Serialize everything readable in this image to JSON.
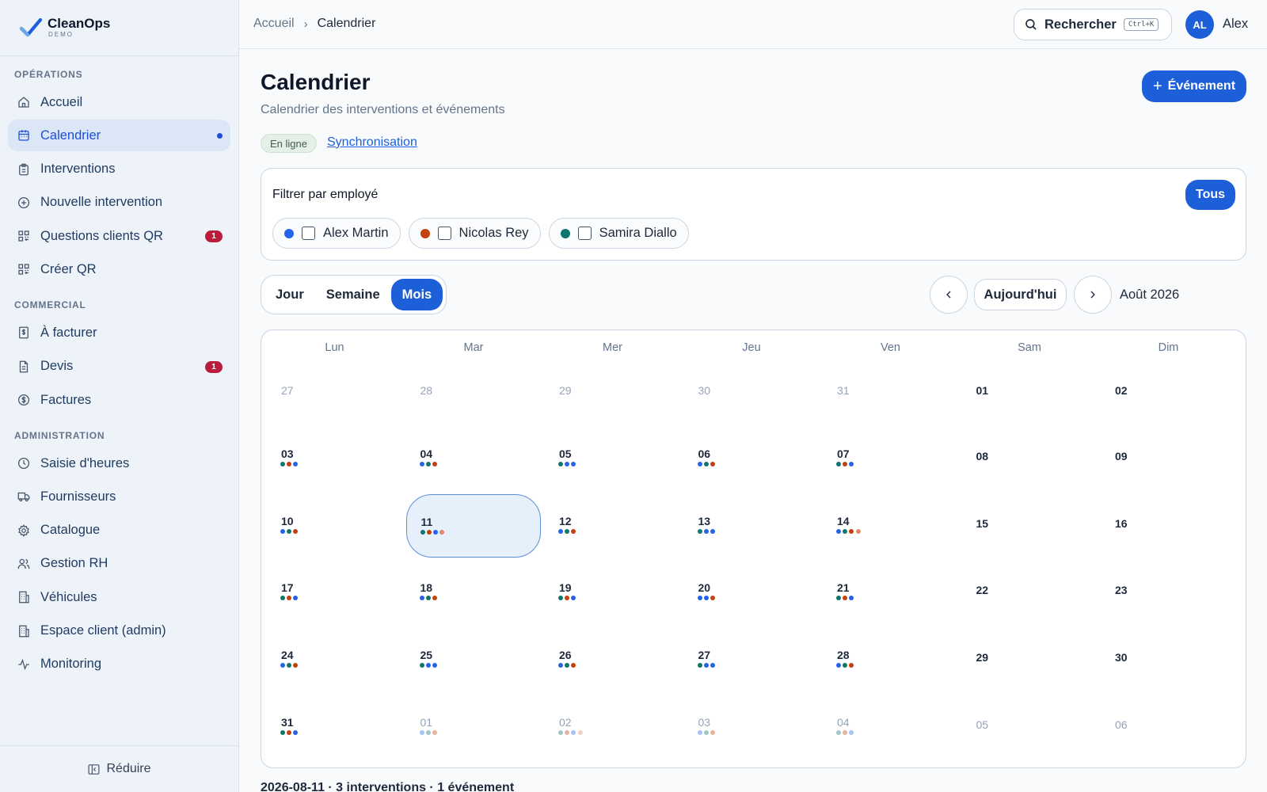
{
  "brand": {
    "name": "CleanOps",
    "sub": "DEMO"
  },
  "sidebar": {
    "sections": [
      {
        "title": "OPÉRATIONS",
        "items": [
          {
            "label": "Accueil",
            "icon": "home-icon"
          },
          {
            "label": "Calendrier",
            "icon": "calendar-icon",
            "active": true
          },
          {
            "label": "Interventions",
            "icon": "clipboard-icon"
          },
          {
            "label": "Nouvelle intervention",
            "icon": "plus-circle-icon"
          },
          {
            "label": "Questions clients QR",
            "icon": "qr-icon",
            "badge": "1"
          },
          {
            "label": "Créer QR",
            "icon": "qr-icon"
          }
        ]
      },
      {
        "title": "COMMERCIAL",
        "items": [
          {
            "label": "À facturer",
            "icon": "invoice-icon"
          },
          {
            "label": "Devis",
            "icon": "document-icon",
            "badge": "1"
          },
          {
            "label": "Factures",
            "icon": "dollar-circle-icon"
          }
        ]
      },
      {
        "title": "ADMINISTRATION",
        "items": [
          {
            "label": "Saisie d'heures",
            "icon": "clock-icon"
          },
          {
            "label": "Fournisseurs",
            "icon": "truck-icon"
          },
          {
            "label": "Catalogue",
            "icon": "gear-icon"
          },
          {
            "label": "Gestion RH",
            "icon": "users-icon"
          },
          {
            "label": "Véhicules",
            "icon": "building-icon"
          },
          {
            "label": "Espace client (admin)",
            "icon": "building-icon"
          },
          {
            "label": "Monitoring",
            "icon": "activity-icon"
          }
        ]
      }
    ],
    "collapse_label": "Réduire"
  },
  "topbar": {
    "breadcrumb_home": "Accueil",
    "breadcrumb_sep": "›",
    "breadcrumb_current": "Calendrier",
    "search_label": "Rechercher",
    "search_shortcut": "Ctrl+K",
    "user_initials": "AL",
    "user_name": "Alex"
  },
  "page": {
    "title": "Calendrier",
    "subtitle": "Calendrier des interventions et événements",
    "add_event_label": "Événement",
    "status": "En ligne",
    "sync_link": "Synchronisation"
  },
  "filter": {
    "title": "Filtrer par employé",
    "all_label": "Tous",
    "employees": [
      {
        "name": "Alex Martin",
        "color": "#2563eb"
      },
      {
        "name": "Nicolas Rey",
        "color": "#c2410c"
      },
      {
        "name": "Samira Diallo",
        "color": "#0f766e"
      }
    ]
  },
  "views": {
    "day": "Jour",
    "week": "Semaine",
    "month": "Mois",
    "active": "month"
  },
  "nav": {
    "today_label": "Aujourd'hui",
    "month_label": "Août 2026"
  },
  "colors": {
    "alex": "#2563eb",
    "nicolas": "#c2410c",
    "samira": "#0f766e",
    "event": "#e08a6d"
  },
  "calendar": {
    "weekdays": [
      "Lun",
      "Mar",
      "Mer",
      "Jeu",
      "Ven",
      "Sam",
      "Dim"
    ],
    "selected": "11",
    "weeks": [
      [
        {
          "n": "27",
          "other": true,
          "dots": []
        },
        {
          "n": "28",
          "other": true,
          "dots": []
        },
        {
          "n": "29",
          "other": true,
          "dots": []
        },
        {
          "n": "30",
          "other": true,
          "dots": []
        },
        {
          "n": "31",
          "other": true,
          "dots": []
        },
        {
          "n": "01",
          "dots": []
        },
        {
          "n": "02",
          "dots": []
        }
      ],
      [
        {
          "n": "03",
          "dots": [
            "samira",
            "nicolas",
            "alex"
          ]
        },
        {
          "n": "04",
          "dots": [
            "alex",
            "samira",
            "nicolas"
          ]
        },
        {
          "n": "05",
          "dots": [
            "samira",
            "alex",
            "alex"
          ]
        },
        {
          "n": "06",
          "dots": [
            "alex",
            "samira",
            "nicolas"
          ]
        },
        {
          "n": "07",
          "dots": [
            "samira",
            "nicolas",
            "alex"
          ]
        },
        {
          "n": "08",
          "dots": []
        },
        {
          "n": "09",
          "dots": []
        }
      ],
      [
        {
          "n": "10",
          "dots": [
            "alex",
            "samira",
            "nicolas"
          ]
        },
        {
          "n": "11",
          "dots": [
            "samira",
            "nicolas",
            "alex",
            "event"
          ]
        },
        {
          "n": "12",
          "dots": [
            "alex",
            "samira",
            "nicolas"
          ]
        },
        {
          "n": "13",
          "dots": [
            "samira",
            "alex",
            "alex"
          ]
        },
        {
          "n": "14",
          "dots": [
            "alex",
            "samira",
            "nicolas",
            "event"
          ]
        },
        {
          "n": "15",
          "dots": []
        },
        {
          "n": "16",
          "dots": []
        }
      ],
      [
        {
          "n": "17",
          "dots": [
            "samira",
            "nicolas",
            "alex"
          ]
        },
        {
          "n": "18",
          "dots": [
            "alex",
            "samira",
            "nicolas"
          ]
        },
        {
          "n": "19",
          "dots": [
            "samira",
            "nicolas",
            "alex"
          ]
        },
        {
          "n": "20",
          "dots": [
            "alex",
            "alex",
            "nicolas"
          ]
        },
        {
          "n": "21",
          "dots": [
            "samira",
            "nicolas",
            "alex"
          ]
        },
        {
          "n": "22",
          "dots": []
        },
        {
          "n": "23",
          "dots": []
        }
      ],
      [
        {
          "n": "24",
          "dots": [
            "alex",
            "samira",
            "nicolas"
          ]
        },
        {
          "n": "25",
          "dots": [
            "samira",
            "alex",
            "alex"
          ]
        },
        {
          "n": "26",
          "dots": [
            "alex",
            "samira",
            "nicolas"
          ]
        },
        {
          "n": "27",
          "dots": [
            "samira",
            "alex",
            "alex"
          ]
        },
        {
          "n": "28",
          "dots": [
            "alex",
            "samira",
            "nicolas"
          ]
        },
        {
          "n": "29",
          "dots": []
        },
        {
          "n": "30",
          "dots": []
        }
      ],
      [
        {
          "n": "31",
          "dots": [
            "samira",
            "nicolas",
            "alex"
          ]
        },
        {
          "n": "01",
          "other": true,
          "dots": [
            "alex",
            "samira",
            "nicolas"
          ]
        },
        {
          "n": "02",
          "other": true,
          "dots": [
            "samira",
            "nicolas",
            "alex",
            "event"
          ]
        },
        {
          "n": "03",
          "other": true,
          "dots": [
            "alex",
            "samira",
            "nicolas"
          ]
        },
        {
          "n": "04",
          "other": true,
          "dots": [
            "samira",
            "nicolas",
            "alex"
          ]
        },
        {
          "n": "05",
          "other": true,
          "dots": []
        },
        {
          "n": "06",
          "other": true,
          "dots": []
        }
      ]
    ]
  },
  "summary": "2026-08-11 · 3 interventions · 1 événement"
}
